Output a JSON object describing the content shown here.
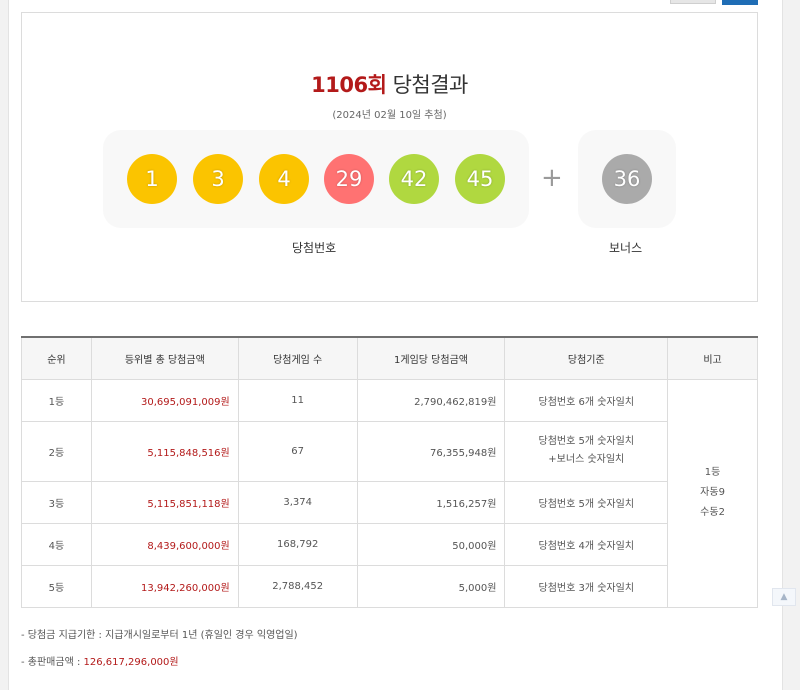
{
  "header": {
    "round": "1106회",
    "title": "당첨결과",
    "draw_date": "(2024년 02월 10일 추첨)"
  },
  "winning": {
    "numbers": [
      {
        "value": "1",
        "color": "#fbc400"
      },
      {
        "value": "3",
        "color": "#fbc400"
      },
      {
        "value": "4",
        "color": "#fbc400"
      },
      {
        "value": "29",
        "color": "#ff7272"
      },
      {
        "value": "42",
        "color": "#b0d840"
      },
      {
        "value": "45",
        "color": "#b0d840"
      }
    ],
    "bonus": {
      "value": "36",
      "color": "#aaaaaa"
    },
    "plus": "+",
    "numbers_label": "당첨번호",
    "bonus_label": "보너스"
  },
  "table": {
    "headers": [
      "순위",
      "등위별 총 당첨금액",
      "당첨게임 수",
      "1게임당 당첨금액",
      "당첨기준",
      "비고"
    ],
    "rows": [
      {
        "rank": "1등",
        "total": "30,695,091,009원",
        "games": "11",
        "per_game": "2,790,462,819원",
        "rule": "당첨번호 6개 숫자일치"
      },
      {
        "rank": "2등",
        "total": "5,115,848,516원",
        "games": "67",
        "per_game": "76,355,948원",
        "rule": "당첨번호 5개 숫자일치",
        "rule2": "+보너스 숫자일치"
      },
      {
        "rank": "3등",
        "total": "5,115,851,118원",
        "games": "3,374",
        "per_game": "1,516,257원",
        "rule": "당첨번호 5개 숫자일치"
      },
      {
        "rank": "4등",
        "total": "8,439,600,000원",
        "games": "168,792",
        "per_game": "50,000원",
        "rule": "당첨번호 4개 숫자일치"
      },
      {
        "rank": "5등",
        "total": "13,942,260,000원",
        "games": "2,788,452",
        "per_game": "5,000원",
        "rule": "당첨번호 3개 숫자일치"
      }
    ],
    "remark": {
      "line1": "1등",
      "line2": "자동9",
      "line3": "수동2"
    }
  },
  "notes": {
    "deadline": "-  당첨금 지급기한 : 지급개시일로부터 1년 (휴일인 경우 익영업일)",
    "total_sales_label": "-  총판매금액 : ",
    "total_sales_value": "126,617,296,000원"
  },
  "colors": {
    "accent_red": "#b31a1a",
    "header_bg": "#f6f6f6"
  }
}
